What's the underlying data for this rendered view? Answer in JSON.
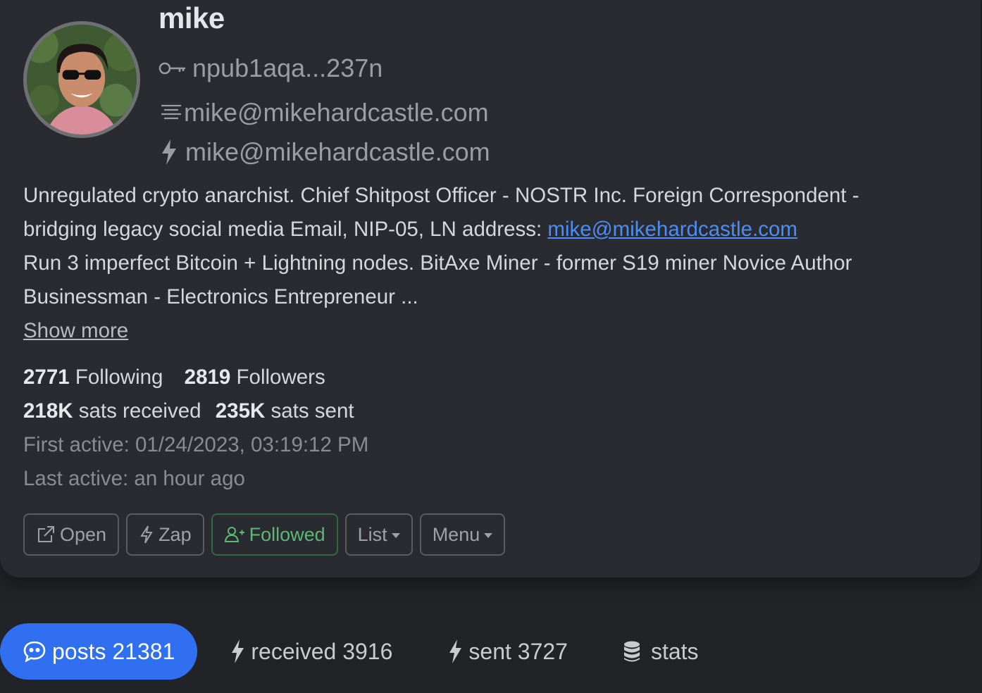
{
  "profile": {
    "name": "mike",
    "npub": "npub1aqa...237n",
    "nip05": "mike@mikehardcastle.com",
    "lightning": "mike@mikehardcastle.com",
    "bio_line1": "Unregulated crypto anarchist. Chief Shitpost Officer - NOSTR Inc. Foreign Correspondent -",
    "bio_line2_prefix": "bridging legacy social media Email, NIP-05, LN address: ",
    "bio_link": "mike@mikehardcastle.com",
    "bio_line3": "Run 3 imperfect Bitcoin + Lightning nodes. BitAxe Miner - former S19 miner Novice Author",
    "bio_line4": "Businessman - Electronics Entrepreneur ...",
    "show_more": "Show more"
  },
  "stats": {
    "following_count": "2771",
    "following_label": "Following",
    "followers_count": "2819",
    "followers_label": "Followers",
    "received_amount": "218K",
    "received_label": "sats received",
    "sent_amount": "235K",
    "sent_label": "sats sent",
    "first_active": "First active: 01/24/2023, 03:19:12 PM",
    "last_active": "Last active: an hour ago"
  },
  "actions": {
    "open": "Open",
    "zap": "Zap",
    "followed": "Followed",
    "list": "List",
    "menu": "Menu"
  },
  "tabs": [
    {
      "label": "posts 21381",
      "icon": "chat-quote-icon",
      "active": true
    },
    {
      "label": "received 3916",
      "icon": "lightning-icon",
      "active": false
    },
    {
      "label": "sent 3727",
      "icon": "lightning-icon",
      "active": false
    },
    {
      "label": "stats",
      "icon": "database-icon",
      "active": false
    }
  ],
  "colors": {
    "background": "#212327",
    "card": "#292b30",
    "accent": "#2f6ff0",
    "link": "#4b8ef5",
    "followed": "#5cb874"
  }
}
